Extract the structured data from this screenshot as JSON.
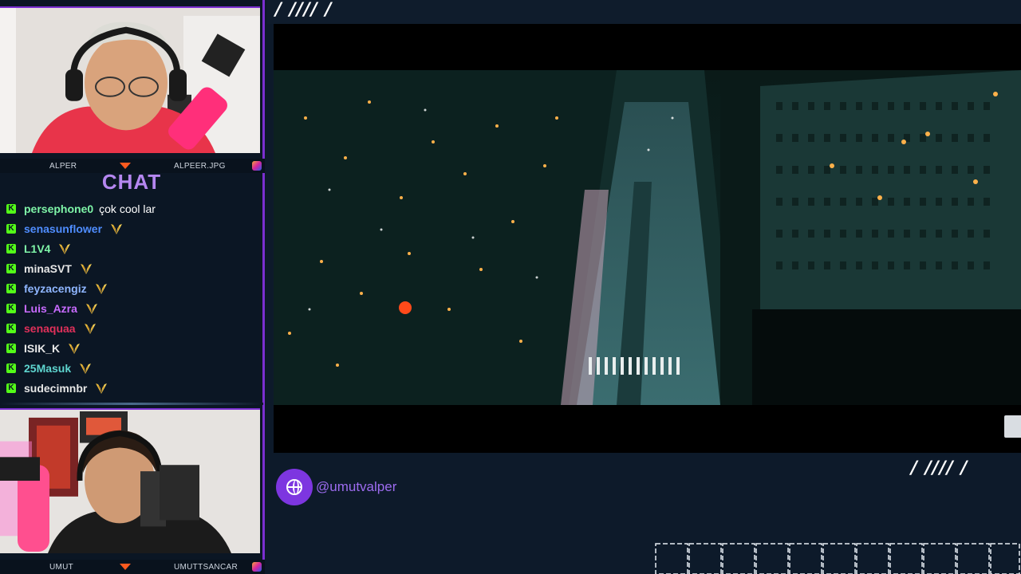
{
  "streamers": {
    "top": {
      "left_name": "ALPER",
      "right_name": "ALPEER.JPG"
    },
    "bottom": {
      "left_name": "UMUT",
      "right_name": "UMUTTSANCAR"
    }
  },
  "chat": {
    "title": "CHAT",
    "badge_letter": "K",
    "messages": [
      {
        "user": "persephone0",
        "color": "#7ff5a8",
        "text": "çok cool lar",
        "emote": false
      },
      {
        "user": "senasunflower",
        "color": "#4f8dff",
        "text": "",
        "emote": true
      },
      {
        "user": "L1V4",
        "color": "#7ff5a8",
        "text": "",
        "emote": true
      },
      {
        "user": "minaSVT",
        "color": "#e6e6e6",
        "text": "",
        "emote": true
      },
      {
        "user": "feyzacengiz",
        "color": "#8fb6ff",
        "text": "",
        "emote": true
      },
      {
        "user": "Luis_Azra",
        "color": "#c86bff",
        "text": "",
        "emote": true
      },
      {
        "user": "senaquaa",
        "color": "#e0305a",
        "text": "",
        "emote": true
      },
      {
        "user": "ISIK_K",
        "color": "#e6e6e6",
        "text": "",
        "emote": true
      },
      {
        "user": "25Masuk",
        "color": "#5ed5cf",
        "text": "",
        "emote": true
      },
      {
        "user": "sudecimnbr",
        "color": "#e6e6e6",
        "text": "",
        "emote": true
      }
    ]
  },
  "decor": {
    "slashes": "/ //// /"
  },
  "social": {
    "handle": "@umutvalper",
    "icon": "globe-icon"
  },
  "colors": {
    "accent": "#7b2fd0",
    "kick_green": "#53fc18",
    "arrow": "#ff5a1f"
  }
}
